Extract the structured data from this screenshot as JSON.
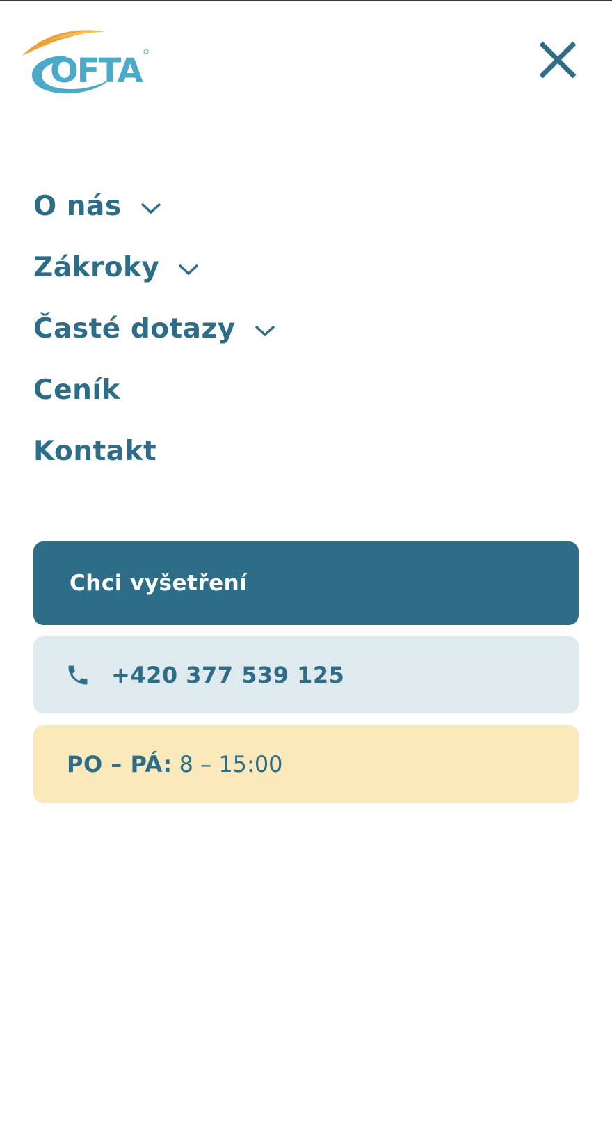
{
  "header": {
    "logo_text": "OFTA",
    "logo_icon": "ofta-logo",
    "close_icon": "close-icon"
  },
  "colors": {
    "primary": "#2e6d87",
    "phone_bg": "#deeaed",
    "hours_bg": "#faeabb",
    "logo_blue": "#4aaac8",
    "logo_orange": "#f0a23a"
  },
  "nav": {
    "items": [
      {
        "label": "O nás",
        "has_submenu": true
      },
      {
        "label": "Zákroky",
        "has_submenu": true
      },
      {
        "label": "Časté dotazy",
        "has_submenu": true
      },
      {
        "label": "Ceník",
        "has_submenu": false
      },
      {
        "label": "Kontakt",
        "has_submenu": false
      }
    ]
  },
  "cta": {
    "label": "Chci vyšetření"
  },
  "contact": {
    "phone_icon": "phone-icon",
    "phone": "+420 377 539 125"
  },
  "hours": {
    "days": "PO – PÁ:",
    "time": "8 – 15:00"
  }
}
